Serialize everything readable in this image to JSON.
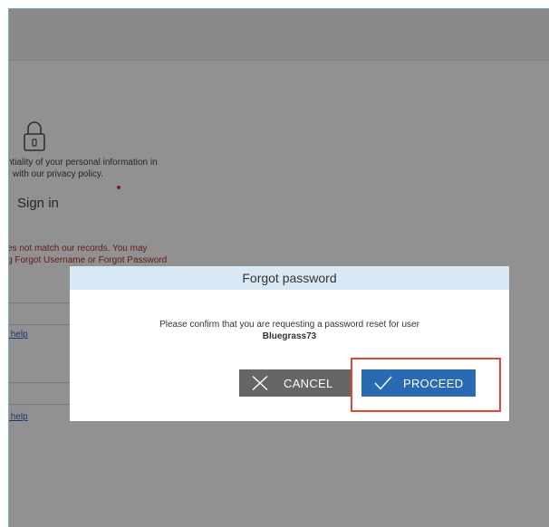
{
  "background_page": {
    "privacy_line_1": "ntiality of your personal information in",
    "privacy_line_2": "with our privacy policy.",
    "sign_in": "Sign in",
    "error_line_1": "es not match our records. You may",
    "error_line_2": "g Forgot Username or Forgot Password",
    "help_link_1": "s help",
    "help_link_2": "s help"
  },
  "dialog": {
    "title": "Forgot password",
    "message": "Please confirm that you are requesting a password reset for user",
    "username": "Bluegrass73",
    "cancel_label": "CANCEL",
    "proceed_label": "PROCEED"
  },
  "colors": {
    "dialog_header": "#d8e9f5",
    "cancel_button": "#666666",
    "proceed_button": "#2a6ab3",
    "highlight": "#e0463c",
    "error_text": "#b03030"
  },
  "icons": {
    "lock": "lock-icon",
    "cancel": "x-icon",
    "proceed": "checkmark-icon"
  }
}
